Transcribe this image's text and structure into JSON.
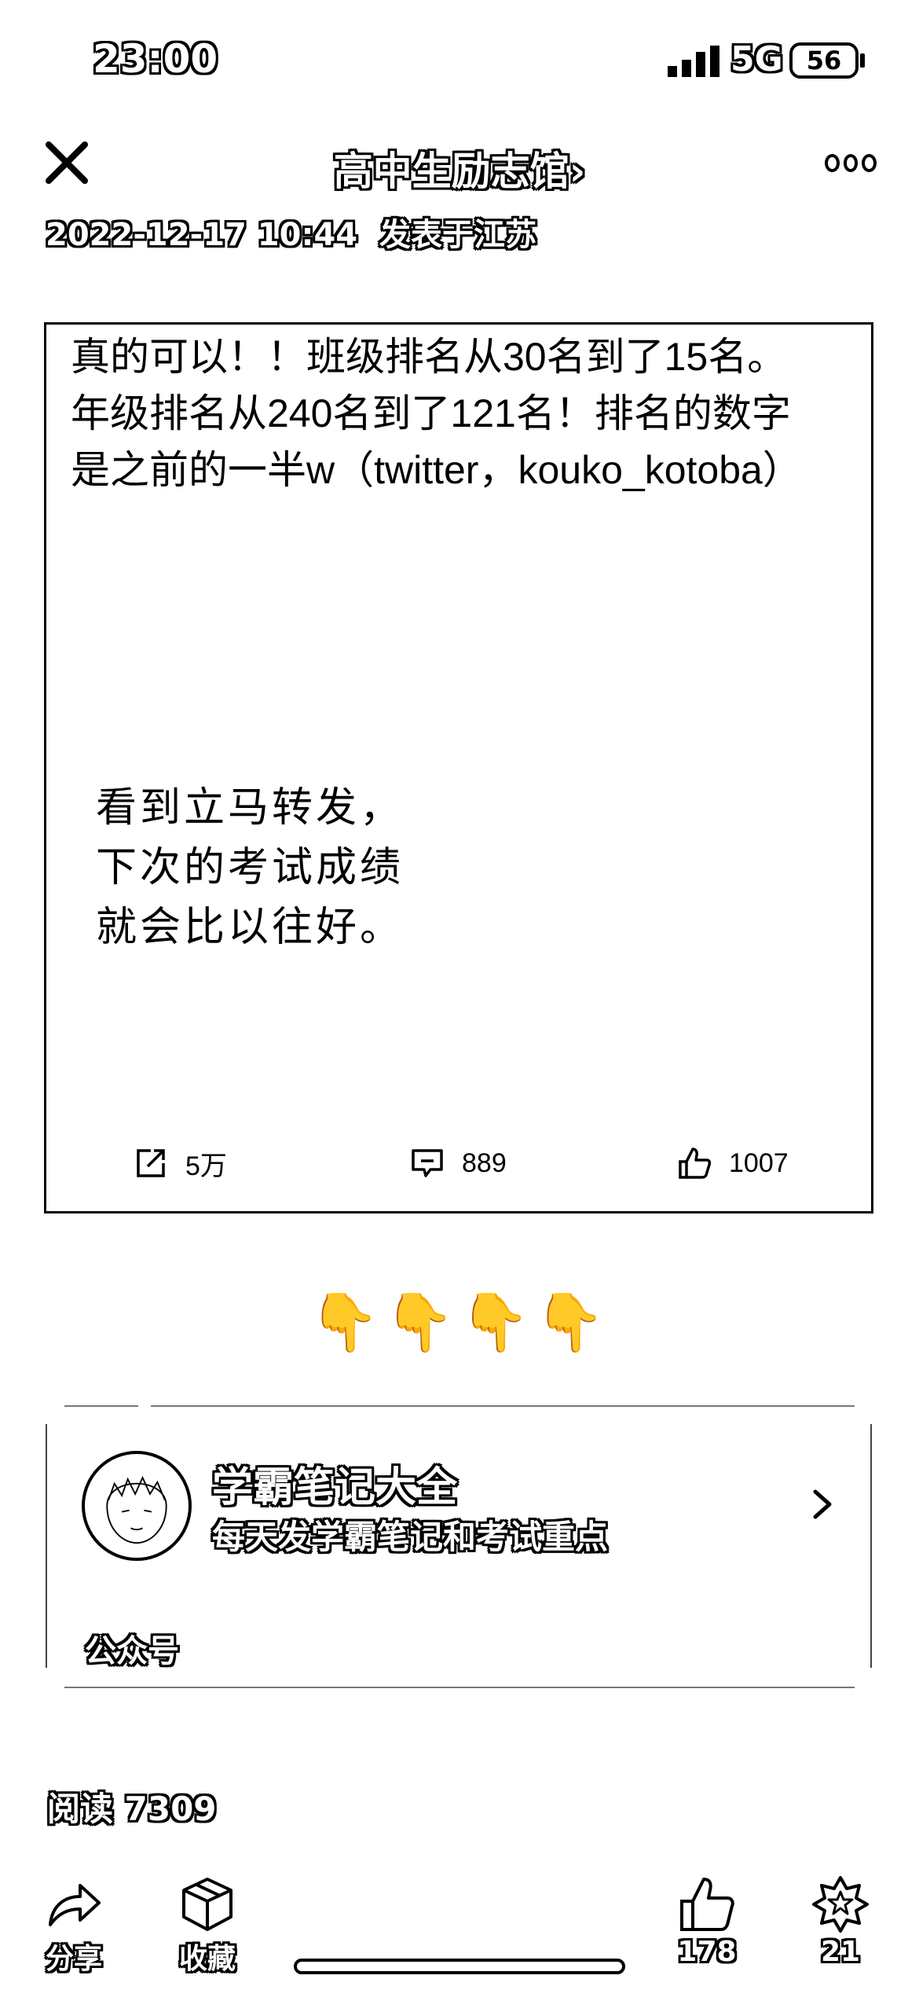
{
  "status_bar": {
    "time": "23:00",
    "network": "5G",
    "battery": "56"
  },
  "header": {
    "title": "高中生励志馆",
    "chevron": "›",
    "date": "2022-12-17 10:44",
    "publish_text": "发表于江苏"
  },
  "post": {
    "text": "真的可以！！班级排名从30名到了15名。年级排名从240名到了121名！排名的数字是之前的一半w（twitter，kouko_kotoba）",
    "quote_lines": [
      "看到立马转发，",
      "下次的考试成绩",
      "就会比以往好。"
    ],
    "stats": {
      "shares": "5万",
      "comments": "889",
      "likes": "1007"
    }
  },
  "pointer_emojis": "👇👇👇👇",
  "account": {
    "name": "学霸笔记大全",
    "description": "每天发学霸笔记和考试重点",
    "type": "公众号"
  },
  "reads": "阅读 7309",
  "bottom_bar": {
    "share_label": "分享",
    "collect_label": "收藏",
    "like_count": "178",
    "recommend_count": "21"
  },
  "icons": [
    "close-icon",
    "more-icon",
    "share-out-icon",
    "comment-icon",
    "thumbs-up-icon",
    "chevron-right-icon",
    "share-arrow-icon",
    "cube-icon",
    "star-badge-icon"
  ]
}
